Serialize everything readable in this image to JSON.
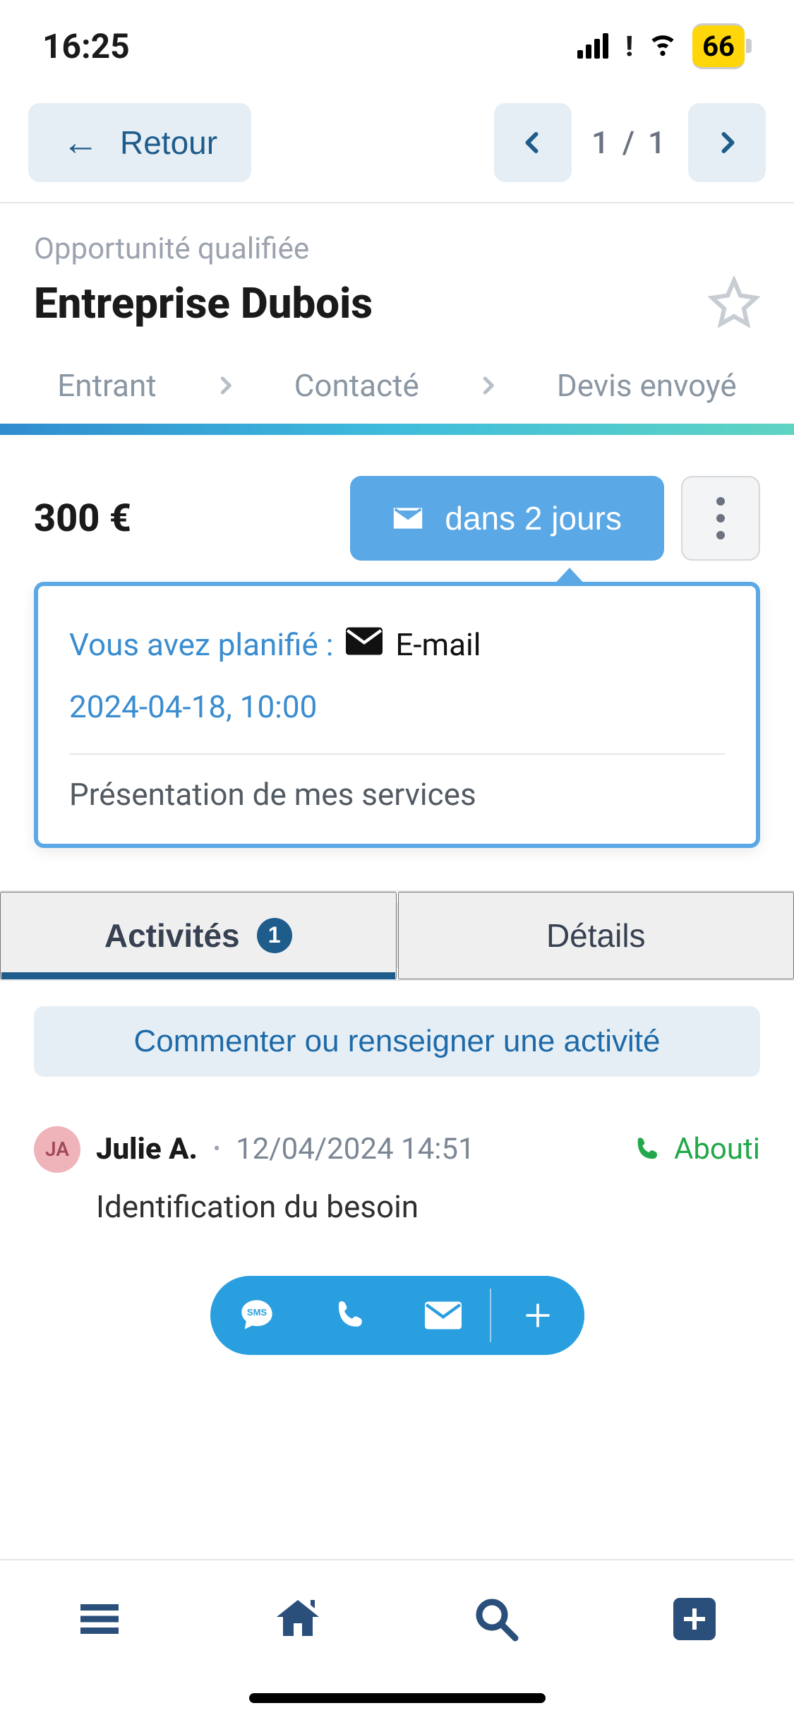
{
  "statusbar": {
    "time": "16:25",
    "battery": "66"
  },
  "nav": {
    "back_label": "Retour",
    "page_indicator": "1 / 1"
  },
  "header": {
    "subtitle": "Opportunité qualifiée",
    "title": "Entreprise Dubois"
  },
  "pipeline": {
    "stage1": "Entrant",
    "stage2": "Contacté",
    "stage3": "Devis envoyé"
  },
  "summary": {
    "amount": "300 €",
    "schedule_label": "dans 2 jours"
  },
  "planned": {
    "prefix": "Vous avez planifié :",
    "type": "E-mail",
    "datetime": "2024-04-18, 10:00",
    "description": "Présentation de mes services"
  },
  "tabs": {
    "activities_label": "Activités",
    "activities_count": "1",
    "details_label": "Détails"
  },
  "comment": {
    "placeholder": "Commenter ou renseigner une activité"
  },
  "activity": {
    "avatar_initials": "JA",
    "author": "Julie A.",
    "timestamp": "12/04/2024 14:51",
    "result": "Abouti",
    "body": "Identification du besoin"
  }
}
